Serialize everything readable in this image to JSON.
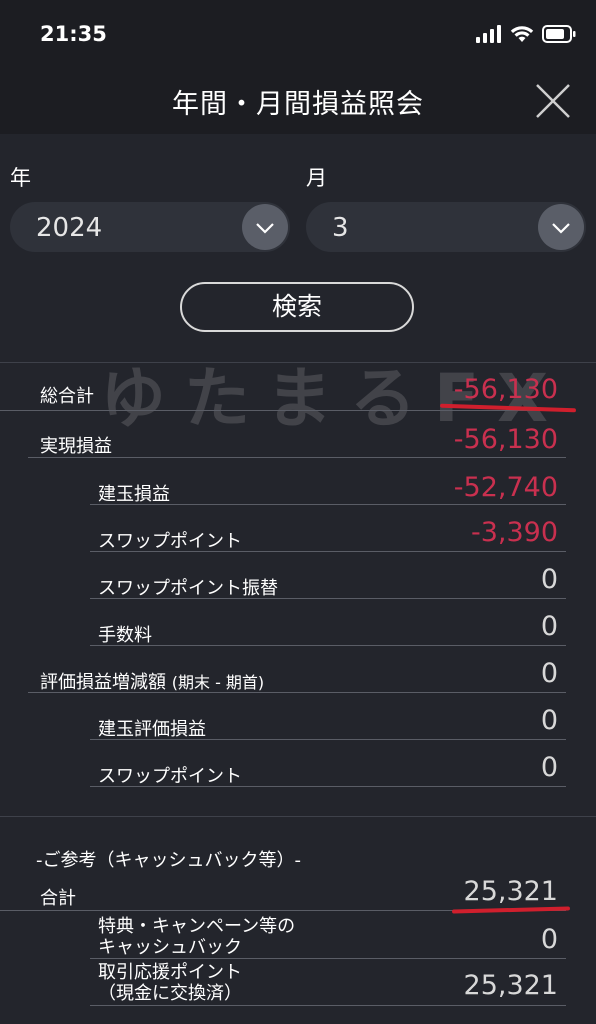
{
  "status_bar": {
    "time": "21:35"
  },
  "header": {
    "title": "年間・月間損益照会"
  },
  "filters": {
    "year_label": "年",
    "year_value": "2024",
    "month_label": "月",
    "month_value": "3",
    "search_label": "検索"
  },
  "watermark": "ゆたまるFX",
  "rows": [
    {
      "label": "総合計",
      "value": "-56,130",
      "negative": true
    },
    {
      "label": "実現損益",
      "value": "-56,130",
      "negative": true
    },
    {
      "label": "建玉損益",
      "value": "-52,740",
      "negative": true
    },
    {
      "label": "スワップポイント",
      "value": "-3,390",
      "negative": true
    },
    {
      "label": "スワップポイント振替",
      "value": "0",
      "negative": false
    },
    {
      "label": "手数料",
      "value": "0",
      "negative": false
    },
    {
      "label": "評価損益増減額",
      "label_sub": "(期末 - 期首)",
      "value": "0",
      "negative": false
    },
    {
      "label": "建玉評価損益",
      "value": "0",
      "negative": false
    },
    {
      "label": "スワップポイント",
      "value": "0",
      "negative": false
    }
  ],
  "reference": {
    "title": "-ご参考（キャッシュバック等）-",
    "total_label": "合計",
    "total_value": "25,321",
    "cashback_label_line1": "特典・キャンペーン等の",
    "cashback_label_line2": "キャッシュバック",
    "cashback_value": "0",
    "points_label_line1": "取引応援ポイント",
    "points_label_line2": "（現金に交換済）",
    "points_value": "25,321"
  },
  "colors": {
    "negative": "#c9304f",
    "underline_mark": "#d01f2d"
  }
}
